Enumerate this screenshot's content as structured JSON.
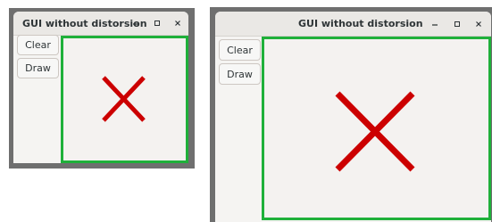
{
  "window_title": "GUI without distorsion",
  "buttons": {
    "clear": "Clear",
    "draw": "Draw"
  },
  "window_controls": [
    "minimize-icon",
    "maximize-icon",
    "close-icon"
  ],
  "colors": {
    "canvas_border": "#1fb03a",
    "x_mark": "#cc0000"
  }
}
